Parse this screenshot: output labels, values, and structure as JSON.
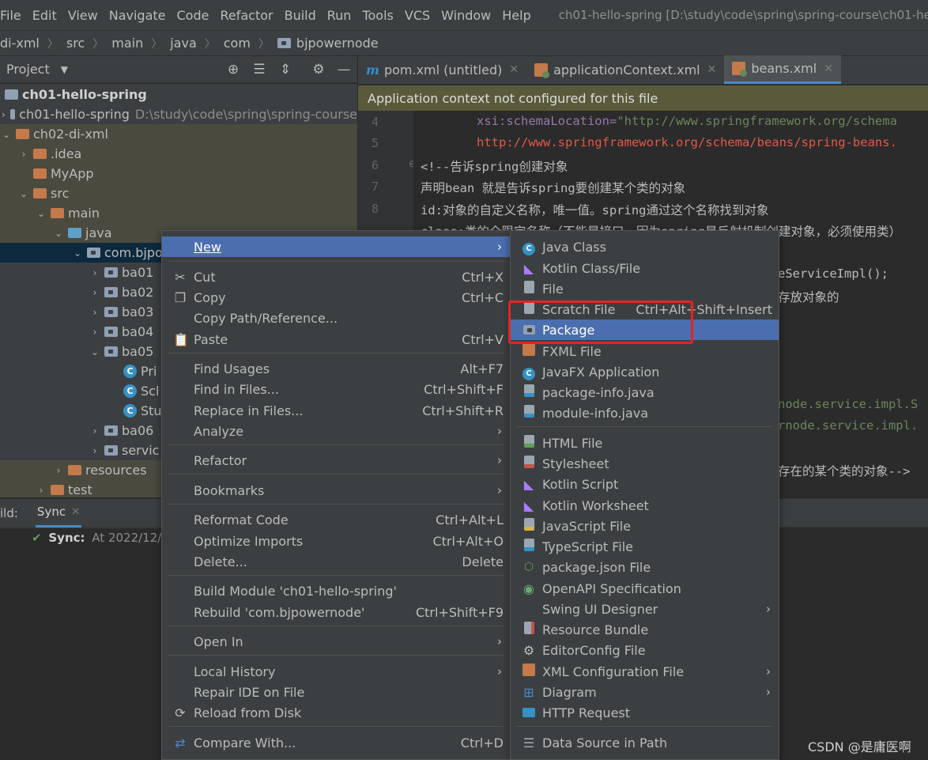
{
  "menubar": {
    "items": [
      "File",
      "Edit",
      "View",
      "Navigate",
      "Code",
      "Refactor",
      "Build",
      "Run",
      "Tools",
      "VCS",
      "Window",
      "Help"
    ],
    "window_title": "ch01-hello-spring [D:\\study\\code\\spring\\spring-course\\ch01-hello"
  },
  "breadcrumb": [
    "di-xml",
    "src",
    "main",
    "java",
    "com",
    "bjpowernode"
  ],
  "project_panel": {
    "title": "Project",
    "icons": [
      "target-icon",
      "expand-all-icon",
      "collapse-all-icon",
      "gear-icon",
      "minimize-icon"
    ]
  },
  "tree": [
    {
      "label": "ch01-hello-spring",
      "bold": true,
      "icon": "module-icon"
    },
    {
      "label": "ch01-hello-spring",
      "path": "D:\\study\\code\\spring\\spring-course",
      "icon": "module-icon"
    },
    {
      "label": "ch02-di-xml",
      "icon": "folder-icon"
    },
    {
      "label": ".idea",
      "icon": "folder-icon"
    },
    {
      "label": "MyApp",
      "icon": "folder-icon"
    },
    {
      "label": "src",
      "icon": "folder-icon"
    },
    {
      "label": "main",
      "icon": "folder-icon"
    },
    {
      "label": "java",
      "icon": "folder-icon"
    },
    {
      "label": "com.bjpo",
      "icon": "package-icon"
    },
    {
      "label": "ba01",
      "icon": "package-icon"
    },
    {
      "label": "ba02",
      "icon": "package-icon"
    },
    {
      "label": "ba03",
      "icon": "package-icon"
    },
    {
      "label": "ba04",
      "icon": "package-icon"
    },
    {
      "label": "ba05",
      "icon": "package-icon"
    },
    {
      "label": "Pri",
      "icon": "class-icon"
    },
    {
      "label": "Scl",
      "icon": "class-icon"
    },
    {
      "label": "Stu",
      "icon": "class-icon"
    },
    {
      "label": "ba06",
      "icon": "package-icon"
    },
    {
      "label": "servic",
      "icon": "package-icon"
    },
    {
      "label": "resources",
      "icon": "folder-icon"
    },
    {
      "label": "test",
      "icon": "folder-icon"
    }
  ],
  "build": {
    "prefix": "ild:",
    "tab": "Sync",
    "status_label": "Sync:",
    "status_text": "At 2022/12/2"
  },
  "editor_tabs": [
    {
      "label": "pom.xml (untitled)",
      "icon": "maven-icon"
    },
    {
      "label": "applicationContext.xml",
      "icon": "spring-xml-icon"
    },
    {
      "label": "beans.xml",
      "icon": "spring-xml-icon",
      "active": true
    }
  ],
  "banner": "Application context not configured for this file",
  "editor": {
    "line_numbers": [
      "4",
      "5",
      "6",
      "7",
      "8"
    ],
    "lines": [
      {
        "attr": "xsi:schemaLocation=",
        "str": "\"http://www.springframework.org/schema"
      },
      {
        "red": "http://www.springframework.org/schema/beans/spring-beans."
      },
      {
        "cmt": "<!--告诉spring创建对象"
      },
      {
        "cmt": "声明bean 就是告诉spring要创建某个类的对象"
      },
      {
        "cmt": "id:对象的自定义名称，唯一值。spring通过这个名称找到对象"
      },
      {
        "cmt": "class:类的全限定名称（不能是接口，因为spring是反射机制创建对象，必须使用类）"
      }
    ],
    "fragments": [
      "eServiceImpl();",
      "存放对象的",
      "node.service.impl.S",
      "rnode.service.impl.",
      "存在的某个类的对象-->"
    ]
  },
  "context_menu": [
    {
      "label": "New",
      "submenu": true,
      "active": true
    },
    {
      "label": "Cut",
      "shortcut": "Ctrl+X",
      "icon": "scissors-icon"
    },
    {
      "label": "Copy",
      "shortcut": "Ctrl+C",
      "icon": "copy-icon"
    },
    {
      "label": "Copy Path/Reference..."
    },
    {
      "label": "Paste",
      "shortcut": "Ctrl+V",
      "icon": "paste-icon"
    },
    {
      "label": "Find Usages",
      "shortcut": "Alt+F7"
    },
    {
      "label": "Find in Files...",
      "shortcut": "Ctrl+Shift+F"
    },
    {
      "label": "Replace in Files...",
      "shortcut": "Ctrl+Shift+R"
    },
    {
      "label": "Analyze",
      "submenu": true
    },
    {
      "label": "Refactor",
      "submenu": true
    },
    {
      "label": "Bookmarks",
      "submenu": true
    },
    {
      "label": "Reformat Code",
      "shortcut": "Ctrl+Alt+L"
    },
    {
      "label": "Optimize Imports",
      "shortcut": "Ctrl+Alt+O"
    },
    {
      "label": "Delete...",
      "shortcut": "Delete"
    },
    {
      "label": "Build Module 'ch01-hello-spring'"
    },
    {
      "label": "Rebuild 'com.bjpowernode'",
      "shortcut": "Ctrl+Shift+F9"
    },
    {
      "label": "Open In",
      "submenu": true
    },
    {
      "label": "Local History",
      "submenu": true
    },
    {
      "label": "Repair IDE on File"
    },
    {
      "label": "Reload from Disk",
      "icon": "reload-icon"
    },
    {
      "label": "Compare With...",
      "shortcut": "Ctrl+D",
      "icon": "compare-icon"
    }
  ],
  "new_submenu": [
    {
      "label": "Java Class",
      "icon": "java-class-icon"
    },
    {
      "label": "Kotlin Class/File",
      "icon": "kotlin-icon"
    },
    {
      "label": "File",
      "icon": "file-icon"
    },
    {
      "label": "Scratch File",
      "shortcut": "Ctrl+Alt+Shift+Insert",
      "icon": "scratch-file-icon"
    },
    {
      "label": "Package",
      "icon": "package-icon",
      "active": true
    },
    {
      "label": "FXML File",
      "icon": "fxml-icon"
    },
    {
      "label": "JavaFX Application",
      "icon": "javafx-icon"
    },
    {
      "label": "package-info.java",
      "icon": "java-file-icon"
    },
    {
      "label": "module-info.java",
      "icon": "java-file-icon"
    },
    {
      "label": "HTML File",
      "icon": "html-icon"
    },
    {
      "label": "Stylesheet",
      "icon": "css-icon"
    },
    {
      "label": "Kotlin Script",
      "icon": "kotlin-icon"
    },
    {
      "label": "Kotlin Worksheet",
      "icon": "kotlin-icon"
    },
    {
      "label": "JavaScript File",
      "icon": "js-icon"
    },
    {
      "label": "TypeScript File",
      "icon": "ts-icon"
    },
    {
      "label": "package.json File",
      "icon": "node-icon"
    },
    {
      "label": "OpenAPI Specification",
      "icon": "openapi-icon"
    },
    {
      "label": "Swing UI Designer",
      "submenu": true
    },
    {
      "label": "Resource Bundle",
      "icon": "resource-bundle-icon"
    },
    {
      "label": "EditorConfig File",
      "icon": "gear-icon"
    },
    {
      "label": "XML Configuration File",
      "submenu": true,
      "icon": "xml-icon"
    },
    {
      "label": "Diagram",
      "submenu": true,
      "icon": "diagram-icon"
    },
    {
      "label": "HTTP Request",
      "icon": "api-icon"
    },
    {
      "label": "Data Source in Path",
      "icon": "database-icon"
    }
  ],
  "watermark": "CSDN @是庸医啊",
  "colors": {
    "accent": "#4b6eaf",
    "highlight_box": "#e8231f",
    "banner": "#5a5a3b"
  }
}
